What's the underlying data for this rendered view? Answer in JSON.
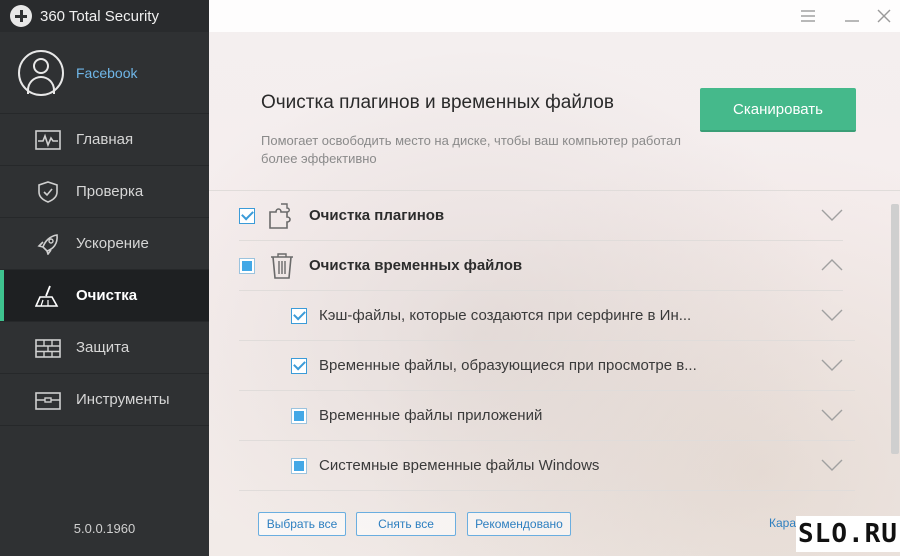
{
  "app": {
    "title": "360 Total Security",
    "version": "5.0.0.1960"
  },
  "profile": {
    "name": "Facebook"
  },
  "nav": [
    {
      "label": "Главная",
      "icon": "pulse-icon"
    },
    {
      "label": "Проверка",
      "icon": "shield-icon"
    },
    {
      "label": "Ускорение",
      "icon": "rocket-icon"
    },
    {
      "label": "Очистка",
      "icon": "broom-icon",
      "active": true
    },
    {
      "label": "Защита",
      "icon": "firewall-icon"
    },
    {
      "label": "Инструменты",
      "icon": "toolbox-icon"
    }
  ],
  "header": {
    "title": "Очистка плагинов и временных файлов",
    "desc": "Помогает освободить место на диске, чтобы ваш компьютер работал более эффективно",
    "scan_label": "Сканировать"
  },
  "items": {
    "plugins": {
      "label": "Очистка плагинов",
      "checked": true
    },
    "temp": {
      "label": "Очистка временных файлов",
      "state": "partial",
      "expanded": true
    },
    "sub": [
      {
        "label": "Кэш-файлы, которые создаются при серфинге в Ин...",
        "checked": true
      },
      {
        "label": "Временные файлы, образующиеся при просмотре в...",
        "checked": true
      },
      {
        "label": "Временные файлы приложений",
        "state": "partial"
      },
      {
        "label": "Системные временные файлы Windows",
        "state": "partial"
      }
    ]
  },
  "footer": {
    "select_all": "Выбрать все",
    "deselect_all": "Снять все",
    "recommended": "Рекомендовано",
    "link": "Кара"
  },
  "watermark": "SLO.RU",
  "colors": {
    "accent": "#45b98b",
    "sidebar": "#2f3133",
    "link": "#2d7fc0"
  }
}
